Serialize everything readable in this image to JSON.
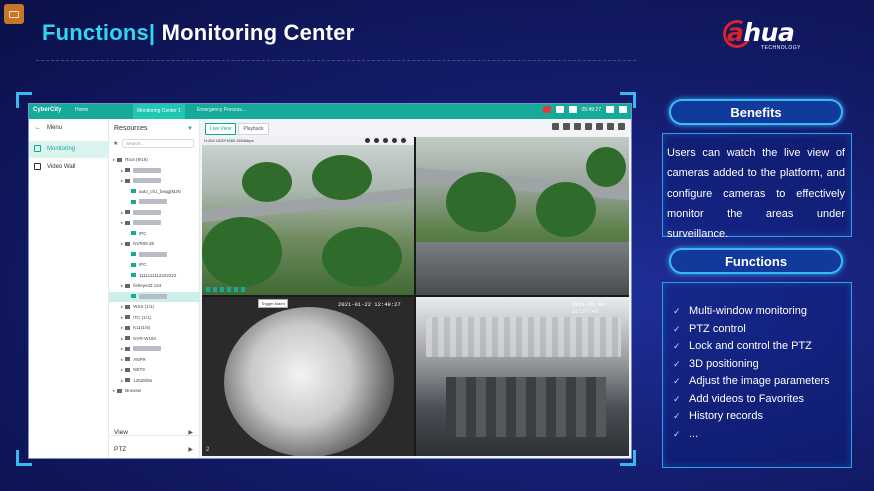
{
  "header": {
    "title_prefix": "Functions|",
    "title_main": " Monitoring Center"
  },
  "logo": {
    "brand_a": "a",
    "brand_rest": "hua",
    "tagline": "TECHNOLOGY",
    "accent": "#d8232a"
  },
  "app": {
    "name": "CyberCity",
    "tabs": [
      "Home",
      "Monitoring Center 1",
      "Emergency Process..."
    ],
    "clock": "05:49:27",
    "menu_label": "Menu",
    "nav": [
      {
        "label": "Monitoring",
        "active": true,
        "icon": "monitor-icon"
      },
      {
        "label": "Video Wall",
        "active": false,
        "icon": "grid-icon"
      }
    ],
    "resources": {
      "title": "Resources",
      "search_placeholder": "Search...",
      "tree": [
        {
          "label": "Root (9/16)",
          "indent": 0,
          "blur": false
        },
        {
          "label": "",
          "indent": 1,
          "blur": true
        },
        {
          "label": "",
          "indent": 1,
          "blur": true
        },
        {
          "label": "auto_ch1_beqg(MJN",
          "indent": 2,
          "blur": false
        },
        {
          "label": "",
          "indent": 2,
          "blur": true
        },
        {
          "label": "",
          "indent": 1,
          "blur": true
        },
        {
          "label": "",
          "indent": 1,
          "blur": true
        },
        {
          "label": "IPC",
          "indent": 2,
          "blur": false
        },
        {
          "label": "NVR08.35",
          "indent": 1,
          "blur": false
        },
        {
          "label": "",
          "indent": 2,
          "blur": true
        },
        {
          "label": "IPC",
          "indent": 2,
          "blur": false
        },
        {
          "label": "1111111112222222",
          "indent": 2,
          "blur": false
        },
        {
          "label": "fisheye43.124",
          "indent": 1,
          "blur": false
        },
        {
          "label": "",
          "indent": 2,
          "blur": true,
          "selected": true
        },
        {
          "label": "WSS (1/1)",
          "indent": 1,
          "blur": false
        },
        {
          "label": "ITC (1/1)",
          "indent": 1,
          "blur": false
        },
        {
          "label": "K11(1/5)",
          "indent": 1,
          "blur": false
        },
        {
          "label": "NVR-W184",
          "indent": 1,
          "blur": false
        },
        {
          "label": "",
          "indent": 1,
          "blur": true
        },
        {
          "label": "ANPR",
          "indent": 1,
          "blur": false
        },
        {
          "label": "NET9",
          "indent": 1,
          "blur": false
        },
        {
          "label": "12528/55",
          "indent": 1,
          "blur": false
        },
        {
          "label": "Browser",
          "indent": 0,
          "blur": false
        }
      ],
      "footer": [
        "View",
        "PTZ"
      ]
    },
    "view_tabs": [
      "Live View",
      "Playback"
    ],
    "videos": {
      "v1_info": "H.264 1920*1080 2603kbps",
      "v3_timestamp": "2021-01-22 12:49:27",
      "v3_alarm": "Trigger Alarm",
      "v3_index": "2",
      "v4_timestamp": "2021-01-04 11:27:47"
    }
  },
  "benefits": {
    "title": "Benefits",
    "text": "Users can watch the live view of cameras added to the platform, and configure cameras to effectively monitor the areas under surveillance."
  },
  "functions": {
    "title": "Functions",
    "items": [
      "Multi-window monitoring",
      "PTZ control",
      "Lock and control the PTZ",
      "3D positioning",
      "Adjust the image parameters",
      "Add videos to Favorites",
      "History records",
      "..."
    ]
  },
  "colors": {
    "title_accent": "#31d6f0",
    "app_teal": "#17a99a",
    "panel_border": "#3ab8f0"
  }
}
